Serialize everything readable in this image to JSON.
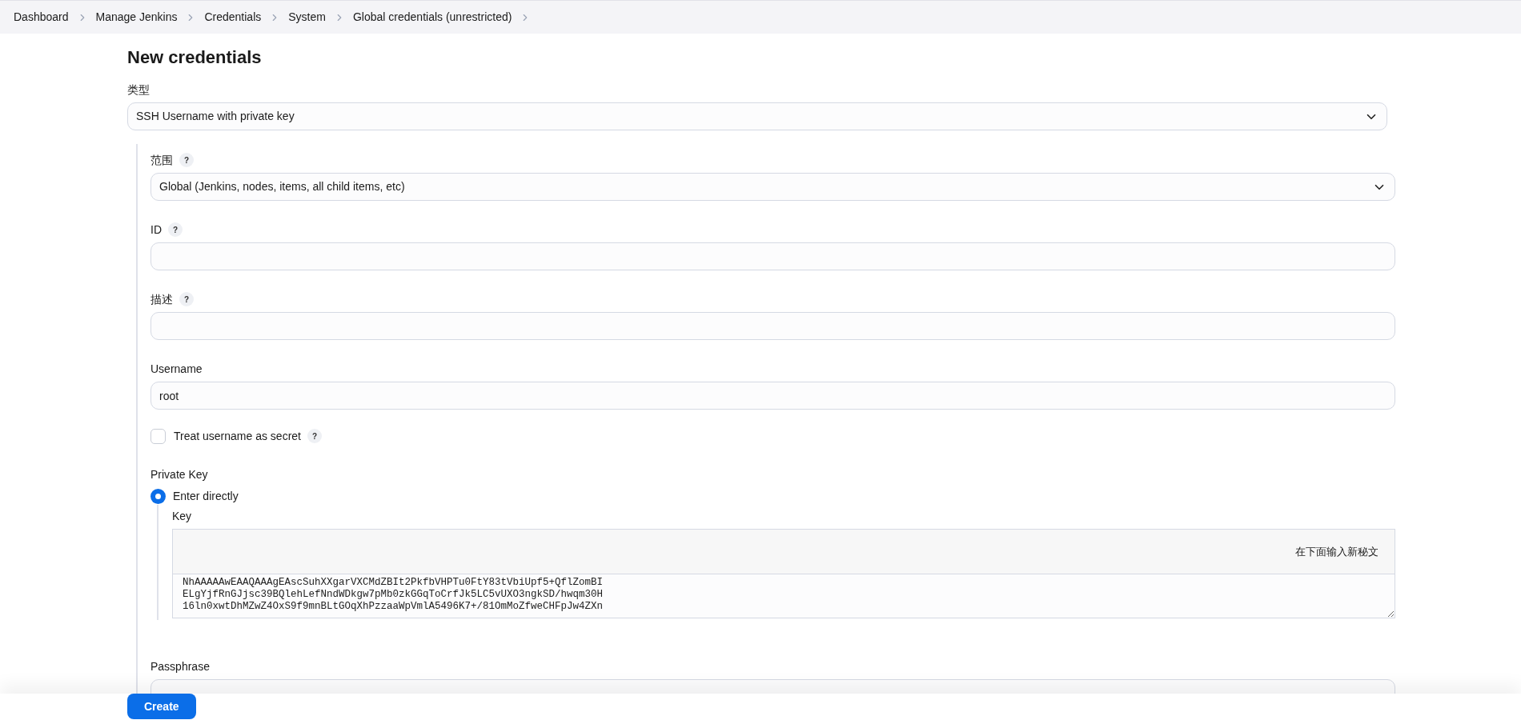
{
  "breadcrumbs": [
    "Dashboard",
    "Manage Jenkins",
    "Credentials",
    "System",
    "Global credentials (unrestricted)"
  ],
  "title": "New credentials",
  "kind_field": {
    "label": "类型",
    "value": "SSH Username with private key"
  },
  "scope": {
    "label": "范围",
    "help": "?",
    "value": "Global (Jenkins, nodes, items, all child items, etc)"
  },
  "id_field": {
    "label": "ID",
    "help": "?"
  },
  "description": {
    "label": "描述",
    "help": "?"
  },
  "username": {
    "label": "Username",
    "value": "root"
  },
  "treat_as_secret": {
    "label": "Treat username as secret",
    "help": "?",
    "checked": false
  },
  "private_key": {
    "label": "Private Key",
    "options": [
      {
        "label": "Enter directly",
        "selected": true
      }
    ],
    "key": {
      "label": "Key",
      "notice": "在下面输入新秘文",
      "lines": [
        "NhAAAAAwEAAQAAAgEAscSuhXXgarVXCMdZBIt2PkfbVHPTu0FtY83tVbiUpf5+QflZomBI",
        "ELgYjfRnGJjsc39BQlehLefNndWDkgw7pMb0zkGGqToCrfJk5LC5vUXO3ngkSD/hwqm30H",
        "16ln0xwtDhMZwZ4OxS9f9mnBLtGOqXhPzzaaWpVmlA5496K7+/81OmMoZfweCHFpJw4ZXn"
      ]
    }
  },
  "passphrase": {
    "label": "Passphrase"
  },
  "create_button": "Create"
}
